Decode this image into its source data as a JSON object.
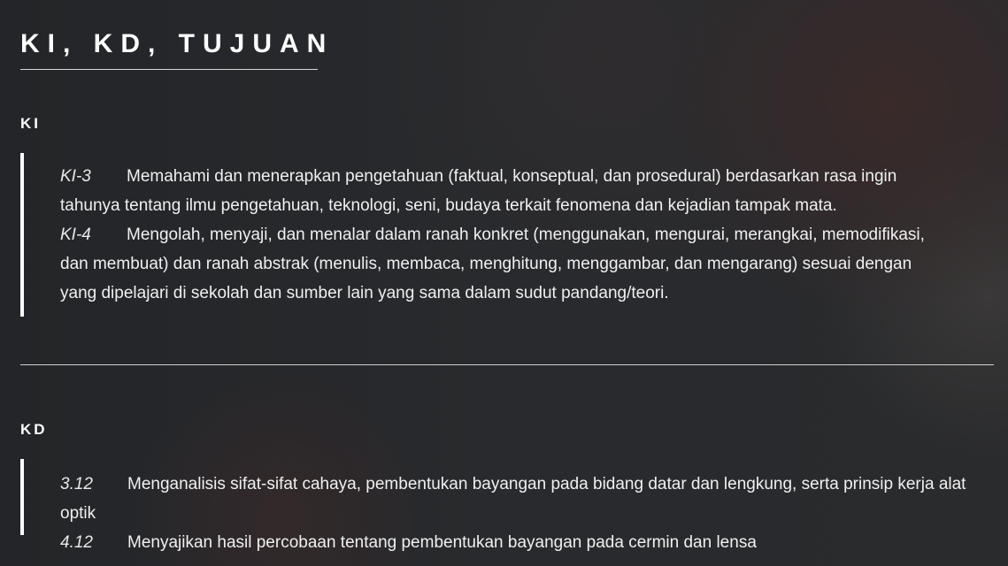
{
  "title": "KI, KD, TUJUAN",
  "ki": {
    "label": "KI",
    "items": [
      {
        "code": "KI-3",
        "text": "Memahami dan menerapkan pengetahuan (faktual, konseptual, dan prosedural) berdasarkan rasa ingin tahunya tentang ilmu pengetahuan, teknologi, seni, budaya terkait fenomena dan kejadian tampak mata."
      },
      {
        "code": "KI-4",
        "text": "Mengolah, menyaji, dan menalar dalam ranah konkret (menggunakan, mengurai, merangkai, memodifikasi, dan membuat) dan ranah abstrak (menulis, membaca, menghitung, menggambar, dan mengarang) sesuai dengan yang dipelajari di sekolah dan sumber lain yang sama dalam sudut pandang/teori."
      }
    ]
  },
  "kd": {
    "label": "KD",
    "items": [
      {
        "code": "3.12",
        "text": "Menganalisis sifat-sifat cahaya, pembentukan bayangan pada bidang datar dan lengkung, serta prinsip kerja alat optik"
      },
      {
        "code": "4.12",
        "text": "Menyajikan hasil percobaan tentang pembentukan bayangan pada cermin dan lensa"
      }
    ]
  }
}
